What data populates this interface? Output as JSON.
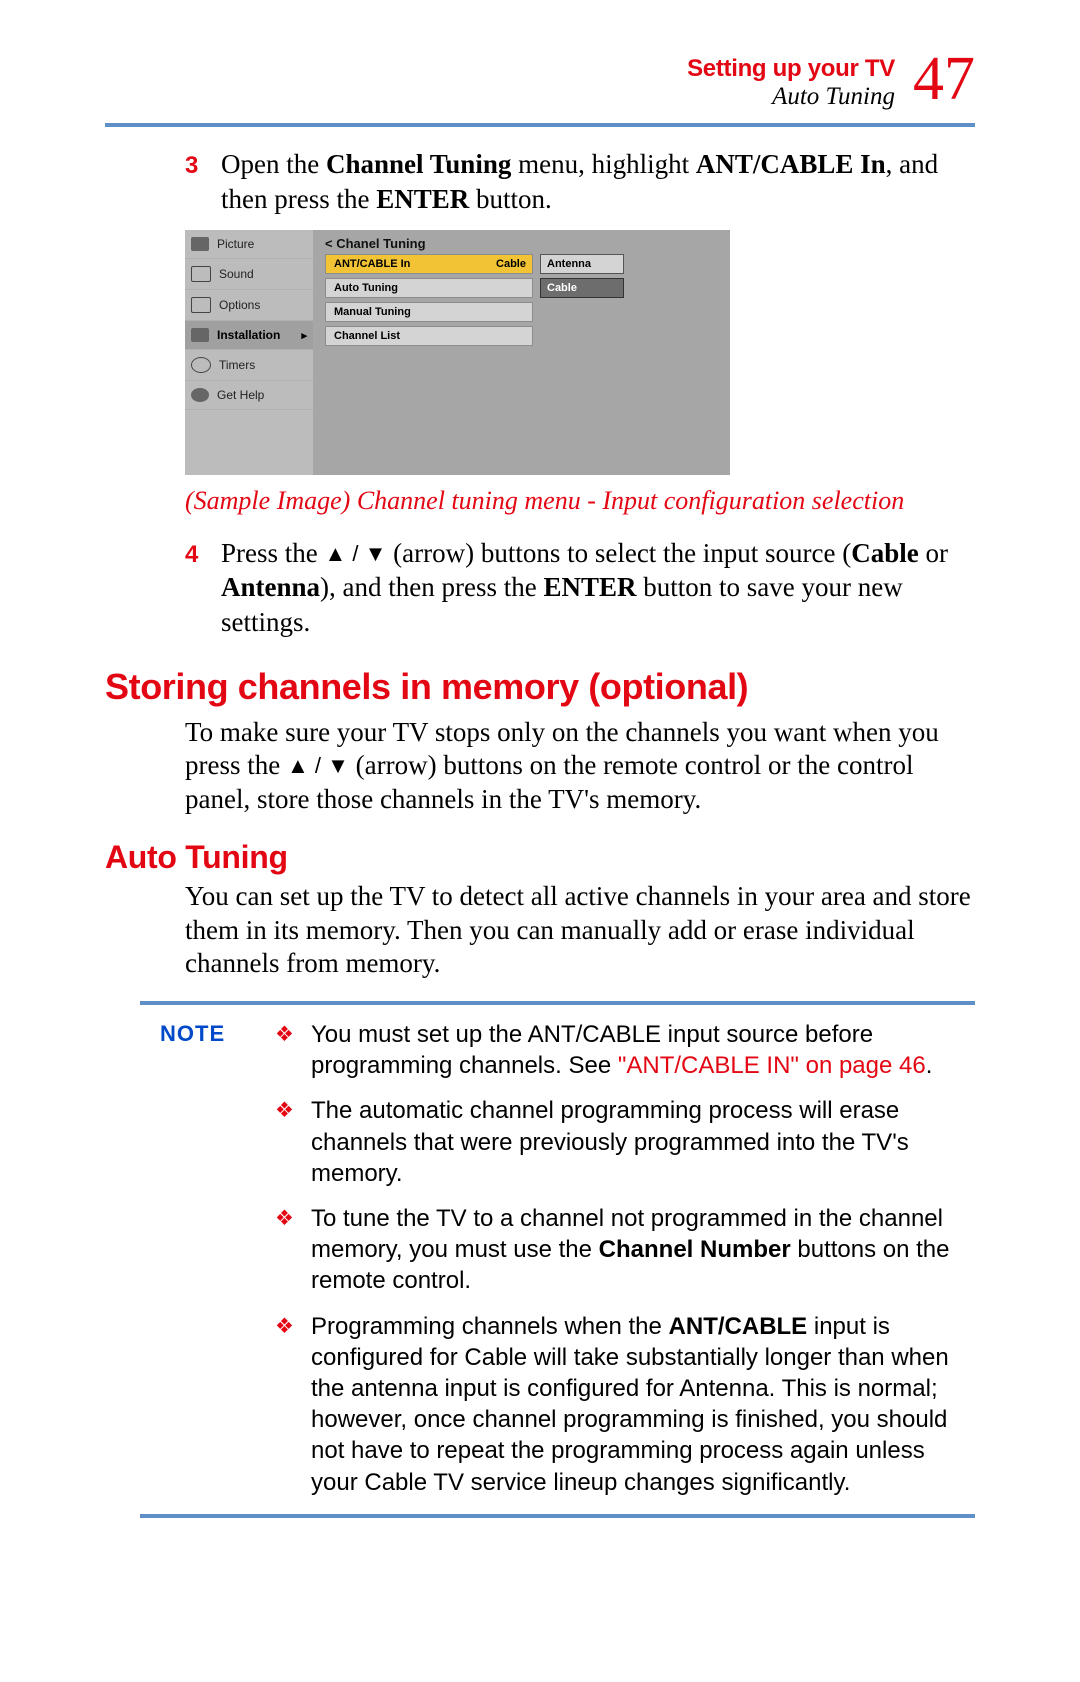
{
  "header": {
    "chapter": "Setting up your TV",
    "section": "Auto Tuning",
    "page_number": "47"
  },
  "steps": {
    "s3": {
      "num": "3",
      "pre": "Open the ",
      "b1": "Channel Tuning",
      "mid1": " menu, highlight ",
      "b2": "ANT/CABLE In",
      "mid2": ", and then press the ",
      "b3": "ENTER",
      "post": " button."
    },
    "s4": {
      "num": "4",
      "pre": "Press the ",
      "arrows": "▲ / ▼",
      "mid1": " (arrow) buttons to select the input source (",
      "b1": "Cable",
      "mid2": " or ",
      "b2": "Antenna",
      "mid3": "), and then press the ",
      "b3": "ENTER",
      "post": " button to save your new settings."
    }
  },
  "tv": {
    "title": "<  Chanel Tuning",
    "side": {
      "picture": "Picture",
      "sound": "Sound",
      "options": "Options",
      "installation": "Installation",
      "timers": "Timers",
      "help": "Get Help"
    },
    "rows": {
      "r1": "ANT/CABLE In",
      "r1_val": "Cable",
      "r2": "Auto Tuning",
      "r3": "Manual Tuning",
      "r4": "Channel List"
    },
    "opts": {
      "antenna": "Antenna",
      "cable": "Cable"
    }
  },
  "caption": "(Sample Image) Channel tuning menu - Input configuration selection",
  "h_storing": "Storing channels in memory (optional)",
  "para_storing": {
    "pre": "To make sure your TV stops only on the channels you want when you press the ",
    "arrows": "▲ / ▼",
    "post": " (arrow) buttons on the remote control or the control panel, store those channels in the TV's memory."
  },
  "h_auto": "Auto Tuning",
  "para_auto": "You can set up the TV to detect all active channels in your area and store them in its memory. Then you can manually add or erase individual channels from memory.",
  "note": {
    "label": "NOTE",
    "items": {
      "n1": {
        "pre": "You must set up the ANT/CABLE input source before programming channels. See ",
        "link": "\"ANT/CABLE IN\" on page 46",
        "post": "."
      },
      "n2": "The automatic channel programming process will erase channels that were previously programmed into the TV's memory.",
      "n3": {
        "pre": "To tune the TV to a channel not programmed in the channel memory, you must use the ",
        "b": "Channel Number",
        "post": " buttons on the remote control."
      },
      "n4": {
        "pre": "Programming channels when the ",
        "b": "ANT/CABLE",
        "post": " input is configured for Cable will take substantially longer than when the antenna input is configured for Antenna. This is normal; however, once channel programming is finished, you should not have to repeat the programming process again unless your Cable TV service lineup changes significantly."
      }
    }
  }
}
